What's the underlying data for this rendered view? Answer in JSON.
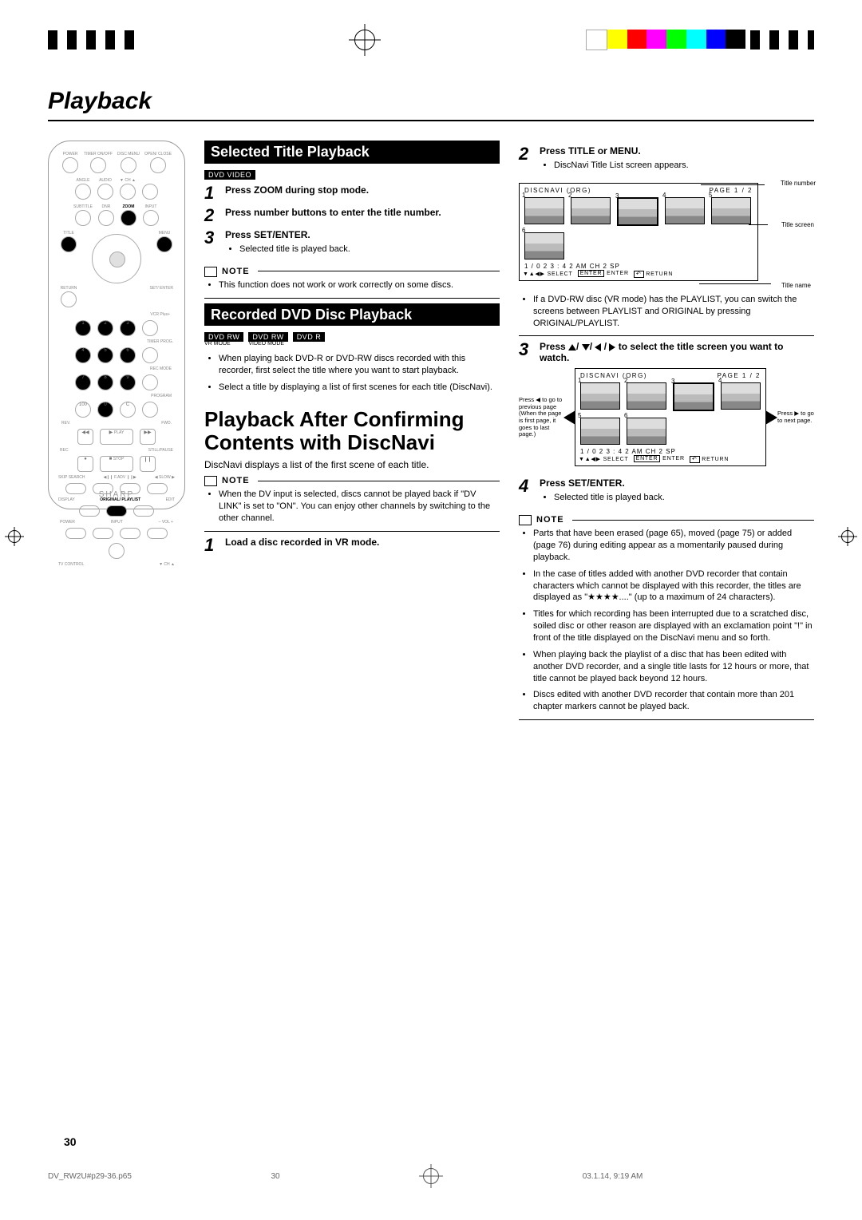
{
  "page": {
    "title": "Playback",
    "number": "30"
  },
  "remote": {
    "brand": "SHARP",
    "labels": {
      "power": "POWER",
      "timer": "TIMER\nON/OFF",
      "disc": "DISC\nMENU",
      "open_close": "OPEN/\nCLOSE",
      "angle": "ANGLE",
      "audio": "AUDIO",
      "ch_down": "CH",
      "ch_up": "",
      "subtitle": "SUBTITLE",
      "dnr": "DNR",
      "zoom": "ZOOM",
      "input": "INPUT",
      "title": "TITLE",
      "menu": "MENU",
      "set_enter": "SET/\nENTER",
      "return": "RETURN",
      "vcrplus": "VCR Plus+",
      "timer_prog": "TIMER PROG.",
      "rec_mode": "REC MODE",
      "program": "PROGRAM",
      "rev": "REV.",
      "play": "PLAY",
      "fwd": "FWD.",
      "rec": "REC",
      "stop": "STOP",
      "pause": "STILL/PAUSE",
      "skipsearch": "SKIP\nSEARCH",
      "fadv": "F.ADV",
      "slow": "SLOW",
      "display": "DISPLAY",
      "original_playlist": "ORIGINAL/\nPLAYLIST",
      "edit": "EDIT",
      "tv_control": "TV CONTROL",
      "vol": "VOL"
    },
    "zoom_highlight": true
  },
  "col_mid": {
    "sec1": {
      "heading": "Selected Title Playback",
      "badges": [
        "DVD VIDEO"
      ],
      "steps": [
        {
          "n": "1",
          "bold_pre": "Press ",
          "key": "ZOOM",
          "bold_post": " during stop mode."
        },
        {
          "n": "2",
          "text": "Press number buttons to enter the title number."
        },
        {
          "n": "3",
          "bold_pre": "Press ",
          "key": "SET/ENTER",
          "bold_post": ".",
          "sub_bullets": [
            "Selected title is played back."
          ]
        }
      ],
      "note_head": "NOTE",
      "note_bullets": [
        "This function does not work or work correctly on some discs."
      ]
    },
    "sec2": {
      "heading": "Recorded DVD Disc Playback",
      "badges": [
        "DVD RW",
        "DVD RW",
        "DVD R"
      ],
      "badge_subs": [
        "VR MODE",
        "VIDEO MODE",
        ""
      ],
      "bullets": [
        "When playing back DVD-R or DVD-RW discs recorded with this recorder, first select the title where you want to start playback.",
        "Select a title by displaying a list of first scenes for each title (DiscNavi)."
      ]
    },
    "sec3": {
      "title": "Playback After Confirming Contents with DiscNavi",
      "para": "DiscNavi displays a list of the first scene of each title.",
      "note_head": "NOTE",
      "note_bullets": [
        "When the DV input is selected, discs cannot be played back if \"DV LINK\" is set to \"ON\". You can enjoy other channels by switching to the other channel."
      ],
      "step1": {
        "n": "1",
        "text": "Load a disc recorded in VR mode."
      }
    }
  },
  "col_right": {
    "step2": {
      "n": "2",
      "bold_pre": "Press ",
      "keys": "TITLE or MENU",
      "bold_post": ".",
      "sub_bullets": [
        "DiscNavi Title List screen appears."
      ]
    },
    "discnavi1": {
      "hdr_left": "DISCNAVI (ORG)",
      "hdr_right": "PAGE  1 /  2",
      "meta": "1 / 0 2       3 : 4 2 AM   CH      2   SP",
      "ctrl_select": "SELECT",
      "ctrl_enter": "ENTER",
      "ctrl_return": "RETURN",
      "callout_title_number": "Title number",
      "callout_title_screen": "Title screen",
      "callout_title_name": "Title name"
    },
    "post2_bullets": [
      "If a DVD-RW disc (VR mode) has the PLAYLIST, you can switch the screens between PLAYLIST and ORIGINAL by pressing ORIGINAL/PLAYLIST."
    ],
    "post2_bold_key": "ORIGINAL/PLAYLIST",
    "step3": {
      "n": "3",
      "text_pre": "Press ",
      "text_icons": "▲/ ▼/ ◀ / ▶",
      "text_post": " to select the title screen you want to watch."
    },
    "discnavi2": {
      "hdr_left": "DISCNAVI (ORG)",
      "hdr_right": "PAGE  1 /  2",
      "meta": "1 / 0 2       3 : 4 2 AM   CH     2   SP",
      "ctrl_select": "SELECT",
      "ctrl_enter": "ENTER",
      "ctrl_return": "RETURN",
      "left_caption": "Press ◀ to go to previous page (When the page is first page, it goes to last page.)",
      "right_caption": "Press ▶ to go to next page."
    },
    "step4": {
      "n": "4",
      "bold_pre": "Press ",
      "key": "SET/ENTER",
      "bold_post": ".",
      "sub_bullets": [
        "Selected title is played back."
      ]
    },
    "note_head": "NOTE",
    "note_bullets": [
      "Parts that have been erased (page 65), moved (page 75) or added (page 76) during editing appear as a momentarily paused during playback.",
      "In the case of titles added with another DVD recorder that contain characters which cannot be displayed with this recorder, the titles are displayed as \"★★★★....\" (up to a maximum of 24 characters).",
      "Titles for which recording has been interrupted due to a scratched disc, soiled disc or other reason are displayed with an exclamation point \"!\" in front of the title displayed on the DiscNavi menu and so forth.",
      "When playing back the playlist of a disc that has been edited with another DVD recorder, and a single title lasts for 12 hours or more, that title cannot be played back beyond 12 hours.",
      "Discs edited with another DVD recorder that contain more than 201 chapter markers cannot be played back."
    ]
  },
  "footer": {
    "file": "DV_RW2U#p29-36.p65",
    "page": "30",
    "timestamp": "03.1.14, 9:19 AM"
  }
}
